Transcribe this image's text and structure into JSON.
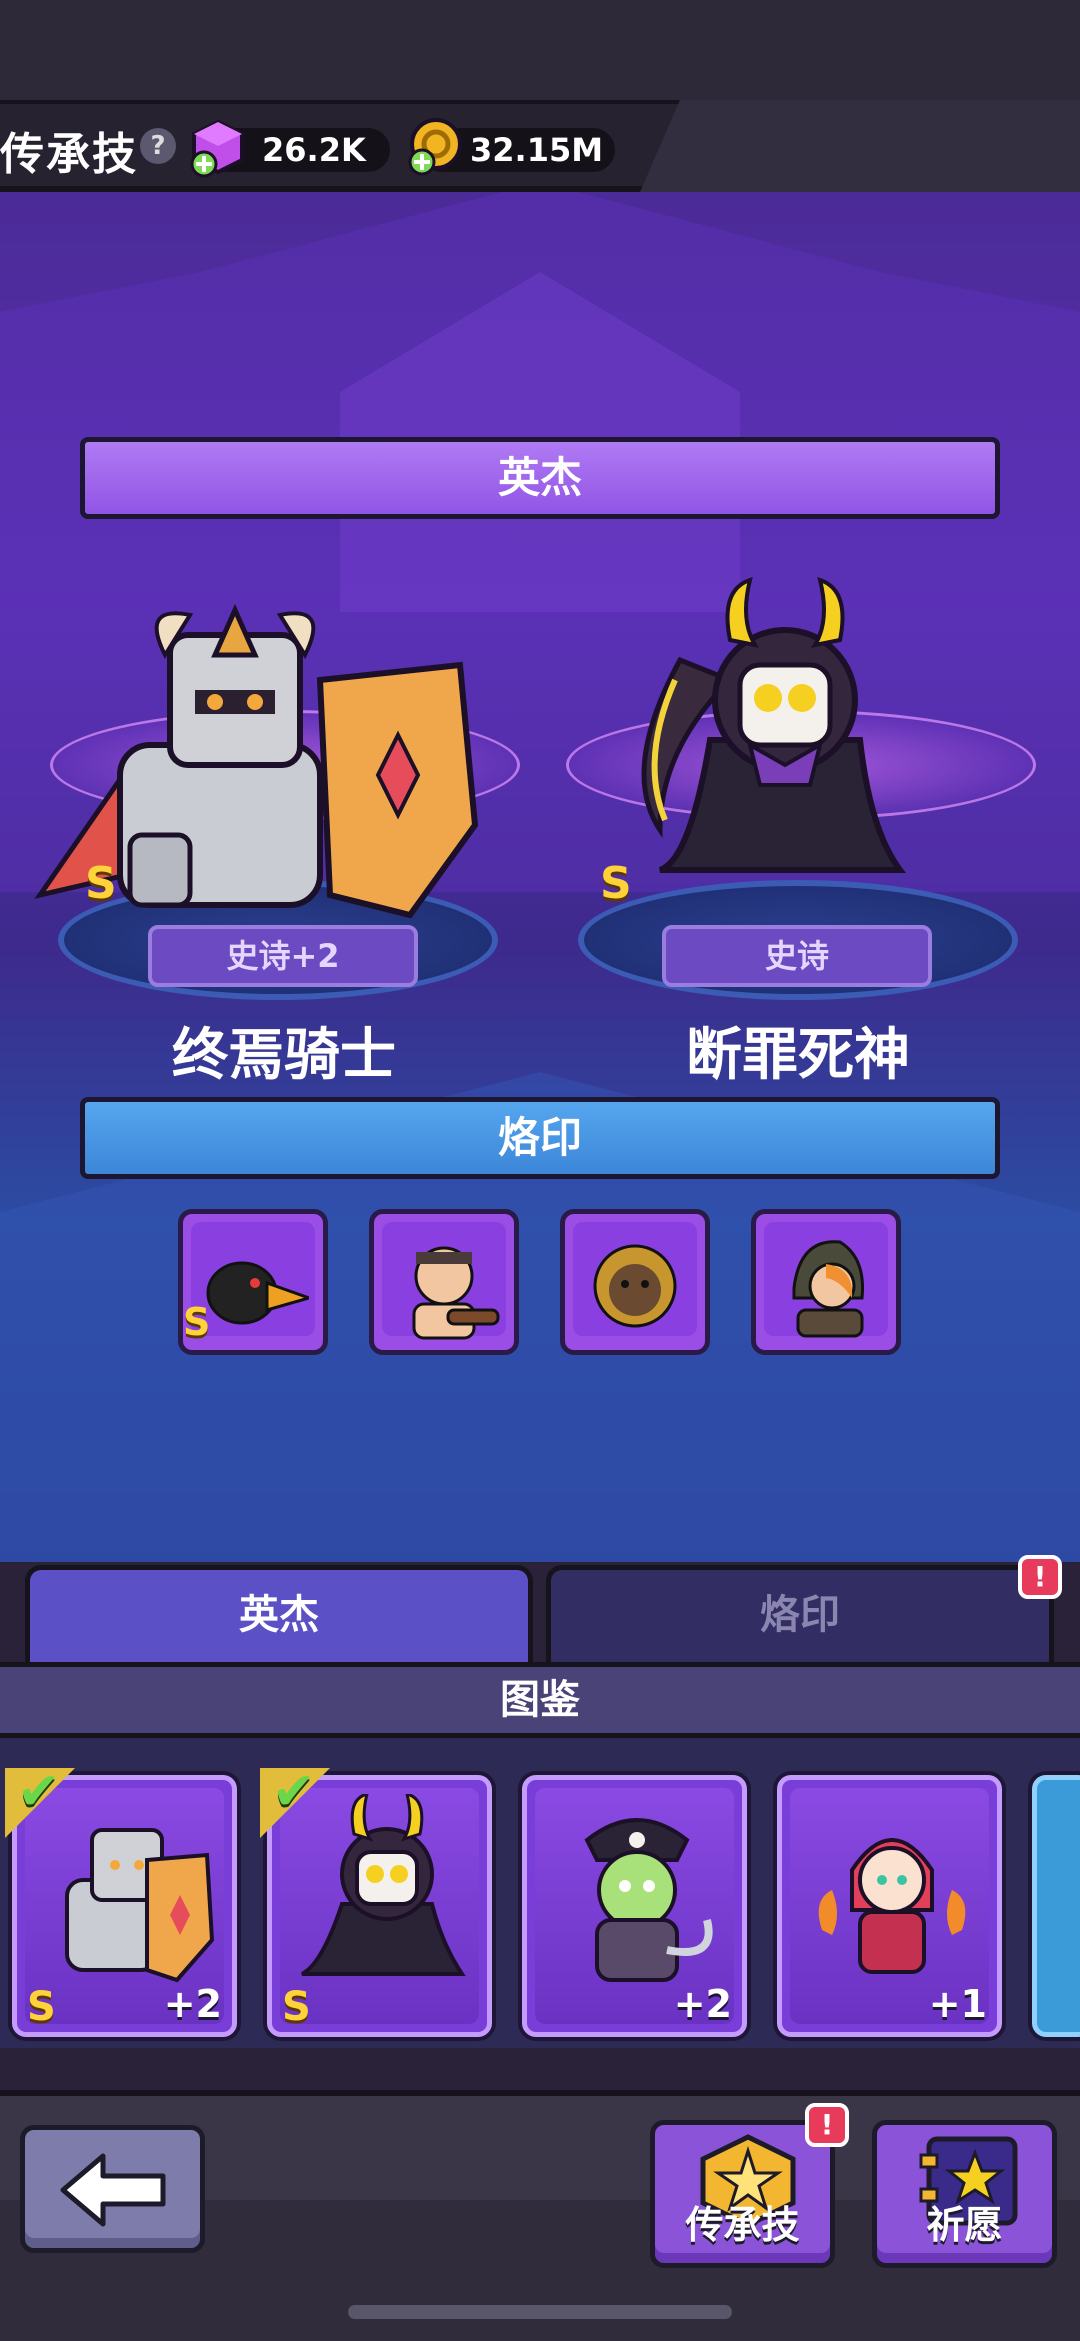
{
  "header": {
    "title": "传承技",
    "help_glyph": "?",
    "gems": "26.2K",
    "coins": "32.15M"
  },
  "epic_section": {
    "ribbon_label": "英杰",
    "heroes": [
      {
        "name": "终焉骑士",
        "rarity": "史诗+2",
        "grade": "S"
      },
      {
        "name": "断罪死神",
        "rarity": "史诗",
        "grade": "S"
      }
    ]
  },
  "mark_section": {
    "ribbon_label": "烙印",
    "slots": [
      {
        "grade": "S"
      },
      {
        "grade": ""
      },
      {
        "grade": ""
      },
      {
        "grade": ""
      }
    ]
  },
  "tabs": {
    "hero": "英杰",
    "mark": "烙印",
    "mark_alert": "!"
  },
  "catalog": {
    "title": "图鉴",
    "cards": [
      {
        "grade": "S",
        "plus": "+2",
        "checked": true
      },
      {
        "grade": "S",
        "plus": "",
        "checked": true
      },
      {
        "grade": "",
        "plus": "+2",
        "checked": false
      },
      {
        "grade": "",
        "plus": "+1",
        "checked": false
      }
    ],
    "check_glyph": "✔"
  },
  "bottom_nav": {
    "inherit_label": "传承技",
    "inherit_alert": "!",
    "wish_label": "祈愿"
  },
  "colors": {
    "accent_purple": "#9155e6",
    "accent_blue": "#3d86d8",
    "gold": "#ffd23a",
    "alert": "#e83a5a"
  }
}
